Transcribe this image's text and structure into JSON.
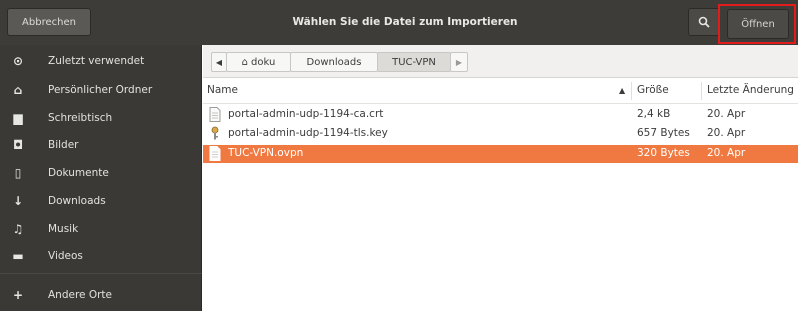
{
  "header": {
    "cancel_label": "Abbrechen",
    "title": "Wählen Sie die Datei zum Importieren",
    "open_label": "Öffnen",
    "highlight_color": "#e21b1b"
  },
  "sidebar": {
    "items": [
      {
        "icon": "clock-icon",
        "glyph": "⊙",
        "label": "Zuletzt verwendet"
      },
      {
        "icon": "home-icon",
        "glyph": "⌂",
        "label": "Persönlicher Ordner"
      },
      {
        "icon": "folder-icon",
        "glyph": "▆",
        "label": "Schreibtisch"
      },
      {
        "icon": "camera-icon",
        "glyph": "◘",
        "label": "Bilder"
      },
      {
        "icon": "document-icon",
        "glyph": "▯",
        "label": "Dokumente"
      },
      {
        "icon": "download-icon",
        "glyph": "↓",
        "label": "Downloads"
      },
      {
        "icon": "music-icon",
        "glyph": "♫",
        "label": "Musik"
      },
      {
        "icon": "video-icon",
        "glyph": "▬",
        "label": "Videos"
      },
      {
        "icon": "plus-icon",
        "glyph": "+",
        "label": "Andere Orte"
      }
    ]
  },
  "pathbar": {
    "crumbs": [
      "doku",
      "Downloads",
      "TUC-VPN"
    ],
    "active": "TUC-VPN"
  },
  "columns": {
    "name": "Name",
    "size": "Größe",
    "modified": "Letzte Änderung"
  },
  "files": [
    {
      "icon": "certificate-file-icon",
      "name": "portal-admin-udp-1194-ca.crt",
      "size": "2,4 kB",
      "modified": "20. Apr",
      "selected": false
    },
    {
      "icon": "key-file-icon",
      "name": "portal-admin-udp-1194-tls.key",
      "size": "657 Bytes",
      "modified": "20. Apr",
      "selected": false
    },
    {
      "icon": "text-file-icon",
      "name": "TUC-VPN.ovpn",
      "size": "320 Bytes",
      "modified": "20. Apr",
      "selected": true
    }
  ],
  "colors": {
    "selection": "#f07941",
    "header_bg": "#3d3c38",
    "sidebar_bg": "#3a3936"
  }
}
